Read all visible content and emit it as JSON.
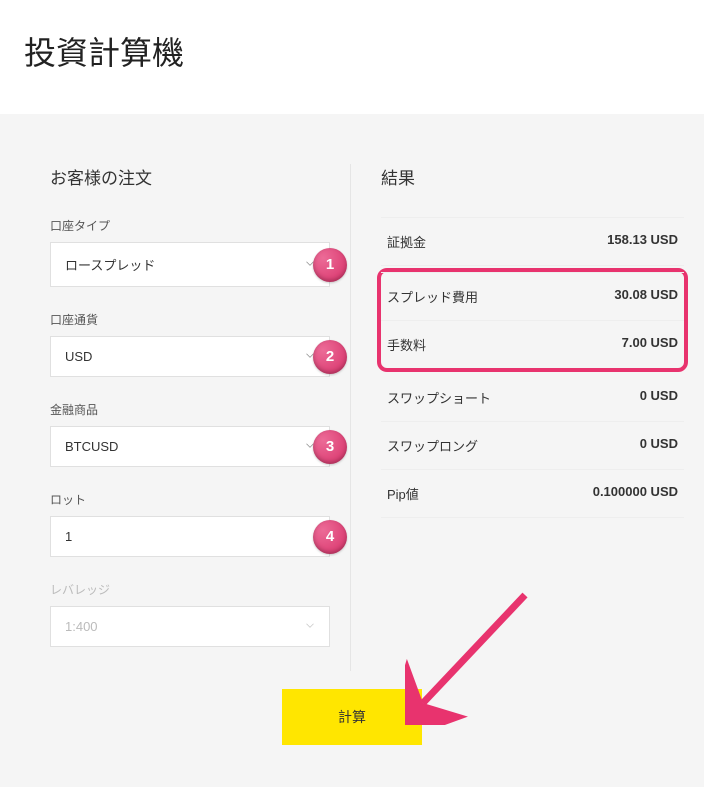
{
  "page_title": "投資計算機",
  "form": {
    "section_title": "お客様の注文",
    "fields": {
      "account_type": {
        "label": "口座タイプ",
        "value": "ロースプレッド",
        "badge": "1"
      },
      "account_currency": {
        "label": "口座通貨",
        "value": "USD",
        "badge": "2"
      },
      "instrument": {
        "label": "金融商品",
        "value": "BTCUSD",
        "badge": "3"
      },
      "lot": {
        "label": "ロット",
        "value": "1",
        "badge": "4"
      },
      "leverage": {
        "label": "レバレッジ",
        "value": "1:400"
      }
    }
  },
  "results": {
    "section_title": "結果",
    "rows": {
      "margin": {
        "label": "証拠金",
        "value": "158.13 USD"
      },
      "spread_cost": {
        "label": "スプレッド費用",
        "value": "30.08 USD"
      },
      "commission": {
        "label": "手数料",
        "value": "7.00 USD"
      },
      "swap_short": {
        "label": "スワップショート",
        "value": "0 USD"
      },
      "swap_long": {
        "label": "スワップロング",
        "value": "0 USD"
      },
      "pip_value": {
        "label": "Pip値",
        "value": "0.100000 USD"
      }
    }
  },
  "calculate_label": "計算",
  "colors": {
    "accent": "#e8336e",
    "button": "#ffe600"
  }
}
